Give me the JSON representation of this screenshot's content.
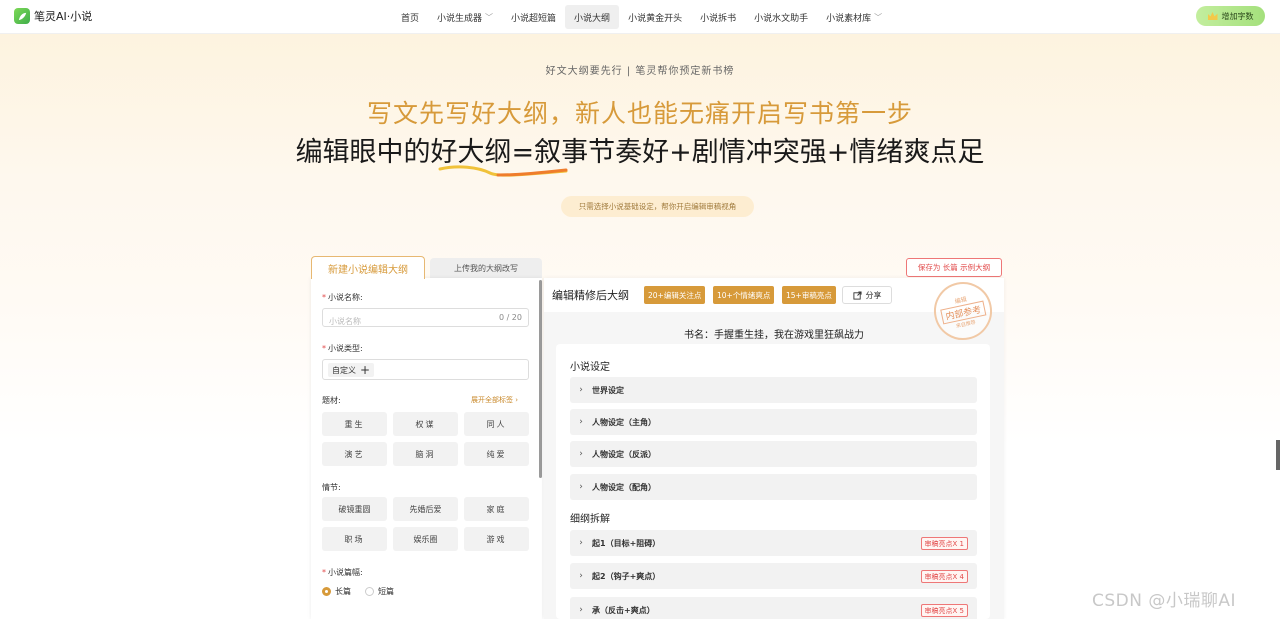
{
  "brand": {
    "name": "笔灵AI·小说"
  },
  "nav": {
    "items": [
      {
        "label": "首页",
        "chevron": false,
        "active": false
      },
      {
        "label": "小说生成器",
        "chevron": true,
        "active": false
      },
      {
        "label": "小说超短篇",
        "chevron": false,
        "active": false
      },
      {
        "label": "小说大纲",
        "chevron": false,
        "active": true
      },
      {
        "label": "小说黄金开头",
        "chevron": false,
        "active": false
      },
      {
        "label": "小说拆书",
        "chevron": false,
        "active": false
      },
      {
        "label": "小说水文助手",
        "chevron": false,
        "active": false
      },
      {
        "label": "小说素材库",
        "chevron": true,
        "active": false
      }
    ],
    "add_words": "增加字数"
  },
  "hero": {
    "tagline": "好文大纲要先行 | 笔灵帮你预定新书榜",
    "headline1": "写文先写好大纲，新人也能无痛开启写书第一步",
    "headline2": "编辑眼中的好大纲=叙事节奏好+剧情冲突强+情绪爽点足",
    "note": "只需选择小说基础设定，帮你开启编辑审稿视角"
  },
  "left": {
    "tab_new": "新建小说编辑大纲",
    "tab_upload": "上传我的大纲改写",
    "name_label": "小说名称:",
    "name_placeholder": "小说名称",
    "name_counter": "0 / 20",
    "type_label": "小说类型:",
    "type_chip": "自定义",
    "theme_label": "题材:",
    "expand_all": "展开全部标签",
    "themes": [
      "重生",
      "权谋",
      "同人",
      "演艺",
      "脑洞",
      "纯爱"
    ],
    "plot_label": "情节:",
    "plots": [
      "破镜重圆",
      "先婚后爱",
      "家庭",
      "职场",
      "娱乐圈",
      "游戏"
    ],
    "length_label": "小说篇幅:",
    "length_options": [
      {
        "label": "长篇",
        "checked": true
      },
      {
        "label": "短篇",
        "checked": false
      }
    ]
  },
  "right": {
    "save_sample": "保存为 长篇 示例大纲",
    "title": "编辑精修后大纲",
    "badges": [
      "20+编辑关注点",
      "10+个情绪爽点",
      "15+审稿亮点"
    ],
    "share": "分享",
    "stamp": {
      "top": "编辑",
      "mid": "内部参考",
      "bottom": "来自推荐"
    },
    "book_name": "书名：手握重生挂，我在游戏里狂飙战力",
    "section1": "小说设定",
    "settings": [
      "世界设定",
      "人物设定（主角）",
      "人物设定（反派）",
      "人物设定（配角）"
    ],
    "section2": "细纲拆解",
    "outline": [
      {
        "label": "起1（目标+阻碍）",
        "tag": "审稿亮点X 1"
      },
      {
        "label": "起2（钩子+爽点）",
        "tag": "审稿亮点X 4"
      },
      {
        "label": "承（反击+爽点）",
        "tag": "审稿亮点X 5"
      }
    ]
  },
  "watermark": "CSDN @小瑞聊AI",
  "colors": {
    "accent": "#d79a3a",
    "brand_green": "#3fae4a",
    "danger": "#e24b4b"
  }
}
